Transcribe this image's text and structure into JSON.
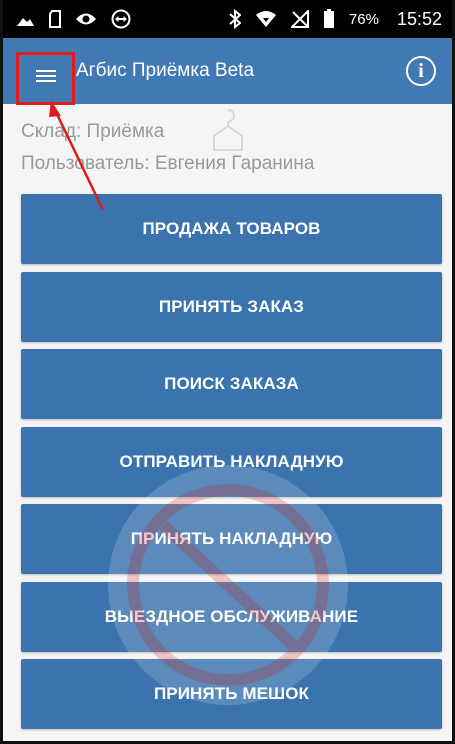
{
  "statusbar": {
    "battery_percent": "76%",
    "time": "15:52"
  },
  "appbar": {
    "title": "Агбис Приёмка Beta",
    "info_glyph": "i"
  },
  "info": {
    "warehouse": "Склад: Приёмка",
    "user": "Пользователь: Евгения Гаранина"
  },
  "buttons": [
    "ПРОДАЖА ТОВАРОВ",
    "ПРИНЯТЬ ЗАКАЗ",
    "ПОИСК ЗАКАЗА",
    "ОТПРАВИТЬ НАКЛАДНУЮ",
    "ПРИНЯТЬ НАКЛАДНУЮ",
    "ВЫЕЗДНОЕ ОБСЛУЖИВАНИЕ",
    "ПРИНЯТЬ МЕШОК"
  ],
  "colors": {
    "appbar": "#4079b4",
    "button": "#3a73ad",
    "highlight": "#e01b1b"
  },
  "icons": [
    "gallery-icon",
    "sd-card-icon",
    "eye-icon",
    "teamviewer-icon",
    "bluetooth-icon",
    "wifi-icon",
    "no-sim-icon",
    "battery-icon",
    "menu-icon",
    "info-icon"
  ]
}
